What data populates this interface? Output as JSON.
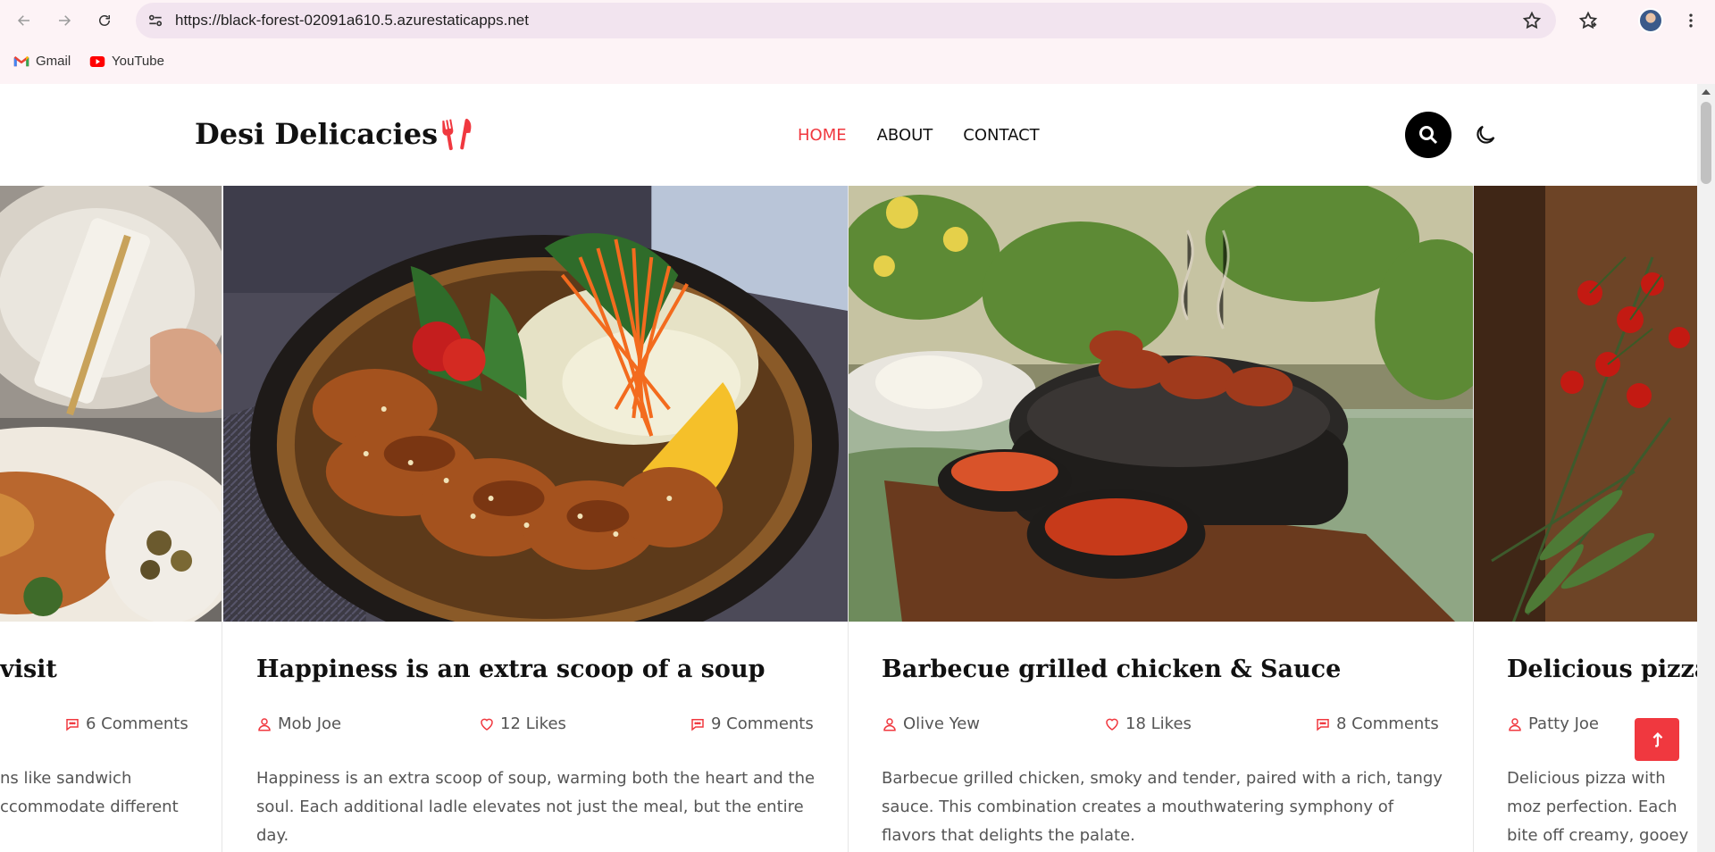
{
  "browser": {
    "url": "https://black-forest-02091a610.5.azurestaticapps.net",
    "bookmarks": [
      {
        "label": "Gmail",
        "icon": "gmail-icon"
      },
      {
        "label": "YouTube",
        "icon": "youtube-icon"
      }
    ]
  },
  "site": {
    "logo_text": "Desi Delicacies",
    "nav": [
      {
        "label": "HOME",
        "active": true
      },
      {
        "label": "ABOUT",
        "active": false
      },
      {
        "label": "CONTACT",
        "active": false
      }
    ],
    "accent_color": "#f0383f"
  },
  "cards": [
    {
      "title": "visit",
      "author": "",
      "likes": "",
      "comments": "6 Comments",
      "excerpt": "ns like sandwich ccommodate different"
    },
    {
      "title": "Happiness is an extra scoop of a soup",
      "author": "Mob Joe",
      "likes": "12 Likes",
      "comments": "9 Comments",
      "excerpt": "Happiness is an extra scoop of soup, warming both the heart and the soul. Each additional ladle elevates not just the meal, but the entire day."
    },
    {
      "title": "Barbecue grilled chicken & Sauce",
      "author": "Olive Yew",
      "likes": "18 Likes",
      "comments": "8 Comments",
      "excerpt": "Barbecue grilled chicken, smoky and tender, paired with a rich, tangy sauce. This combination creates a mouthwatering symphony of flavors that delights the palate."
    },
    {
      "title": "Delicious pizza w",
      "author": "Patty Joe",
      "likes": "",
      "comments": "",
      "excerpt": "Delicious pizza with moz perfection. Each bite off creamy, gooey cheese."
    }
  ]
}
